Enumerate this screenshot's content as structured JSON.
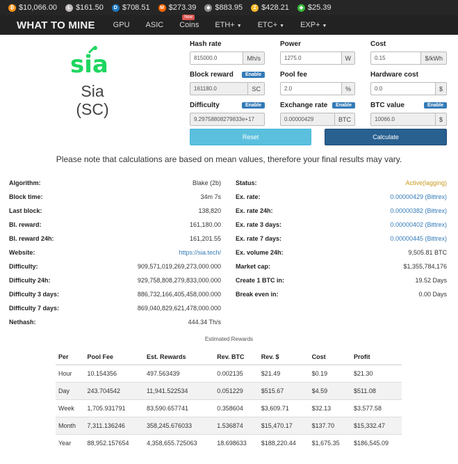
{
  "ticker": [
    {
      "icon": "bitcoin-icon",
      "symbol": "₿",
      "color": "#f7931a",
      "price": "$10,066.00"
    },
    {
      "icon": "litecoin-icon",
      "symbol": "Ł",
      "color": "#bfbbbb",
      "price": "$161.50"
    },
    {
      "icon": "dash-icon",
      "symbol": "D",
      "color": "#1c75bc",
      "price": "$708.51"
    },
    {
      "icon": "monero-icon",
      "symbol": "M",
      "color": "#ff6600",
      "price": "$273.39"
    },
    {
      "icon": "ethereum-icon",
      "symbol": "◆",
      "color": "#8c8c8c",
      "price": "$883.95"
    },
    {
      "icon": "zcash-icon",
      "symbol": "Z",
      "color": "#f4b728",
      "price": "$428.21"
    },
    {
      "icon": "ethereum-classic-icon",
      "symbol": "◆",
      "color": "#3ab83a",
      "price": "$25.39"
    }
  ],
  "nav": {
    "brand": "WHAT TO MINE",
    "items": [
      "GPU",
      "ASIC",
      "Coins",
      "ETH+",
      "ETC+",
      "EXP+"
    ],
    "new_badge": "New"
  },
  "coin": {
    "logo_text": "sia",
    "logo_color": "#1ed660",
    "name": "Sia",
    "symbol": "(SC)"
  },
  "form": {
    "hash_rate": {
      "label": "Hash rate",
      "value": "815000.0",
      "unit": "Mh/s"
    },
    "power": {
      "label": "Power",
      "value": "1275.0",
      "unit": "W"
    },
    "cost": {
      "label": "Cost",
      "value": "0.15",
      "unit": "$/kWh"
    },
    "block_reward": {
      "label": "Block reward",
      "value": "161180.0",
      "unit": "SC",
      "enable": "Enable"
    },
    "pool_fee": {
      "label": "Pool fee",
      "value": "2.0",
      "unit": "%"
    },
    "hardware_cost": {
      "label": "Hardware cost",
      "value": "0.0",
      "unit": "$"
    },
    "difficulty": {
      "label": "Difficulty",
      "value": "9.29758808279833e+17",
      "enable": "Enable"
    },
    "exchange_rate": {
      "label": "Exchange rate",
      "value": "0.00000429",
      "unit": "BTC",
      "enable": "Enable"
    },
    "btc_value": {
      "label": "BTC value",
      "value": "10066.0",
      "unit": "$",
      "enable": "Enable"
    },
    "reset_label": "Reset",
    "calculate_label": "Calculate"
  },
  "note": "Please note that calculations are based on mean values, therefore your final results may vary.",
  "stats_left": [
    {
      "k": "Algorithm:",
      "v": "Blake (2b)"
    },
    {
      "k": "Block time:",
      "v": "34m 7s"
    },
    {
      "k": "Last block:",
      "v": "138,820"
    },
    {
      "k": "Bl. reward:",
      "v": "161,180.00"
    },
    {
      "k": "Bl. reward 24h:",
      "v": "161,201.55"
    },
    {
      "k": "Website:",
      "v": "https://sia.tech/",
      "link": true
    },
    {
      "k": "Difficulty:",
      "v": "909,571,019,269,273,000.000"
    },
    {
      "k": "Difficulty 24h:",
      "v": "929,758,808,279,833,000.000"
    },
    {
      "k": "Difficulty 3 days:",
      "v": "886,732,166,405,458,000.000"
    },
    {
      "k": "Difficulty 7 days:",
      "v": "869,040,829,621,478,000.000"
    },
    {
      "k": "Nethash:",
      "v": "444.34 Th/s"
    }
  ],
  "stats_right": [
    {
      "k": "Status:",
      "v": "Active(lagging)",
      "warn": true
    },
    {
      "k": "Ex. rate:",
      "v": "0.00000429 (Bittrex)",
      "link": true
    },
    {
      "k": "Ex. rate 24h:",
      "v": "0.00000382 (Bittrex)",
      "link": true
    },
    {
      "k": "Ex. rate 3 days:",
      "v": "0.00000402 (Bittrex)",
      "link": true
    },
    {
      "k": "Ex. rate 7 days:",
      "v": "0.00000445 (Bittrex)",
      "link": true
    },
    {
      "k": "Ex. volume 24h:",
      "v": "9,505.81 BTC"
    },
    {
      "k": "Market cap:",
      "v": "$1,355,784,176"
    },
    {
      "k": "Create 1 BTC in:",
      "v": "19.52 Days"
    },
    {
      "k": "Break even in:",
      "v": "0.00 Days"
    }
  ],
  "rewards": {
    "title": "Estimated Rewards",
    "headers": [
      "Per",
      "Pool Fee",
      "Est. Rewards",
      "Rev. BTC",
      "Rev. $",
      "Cost",
      "Profit"
    ],
    "rows": [
      [
        "Hour",
        "10.154356",
        "497.563439",
        "0.002135",
        "$21.49",
        "$0.19",
        "$21.30"
      ],
      [
        "Day",
        "243.704542",
        "11,941.522534",
        "0.051229",
        "$515.67",
        "$4.59",
        "$511.08"
      ],
      [
        "Week",
        "1,705.931791",
        "83,590.657741",
        "0.358604",
        "$3,609.71",
        "$32.13",
        "$3,577.58"
      ],
      [
        "Month",
        "7,311.136246",
        "358,245.676033",
        "1.536874",
        "$15,470.17",
        "$137.70",
        "$15,332.47"
      ],
      [
        "Year",
        "88,952.157654",
        "4,358,655.725063",
        "18.698633",
        "$188,220.44",
        "$1,675.35",
        "$186,545.09"
      ]
    ]
  }
}
